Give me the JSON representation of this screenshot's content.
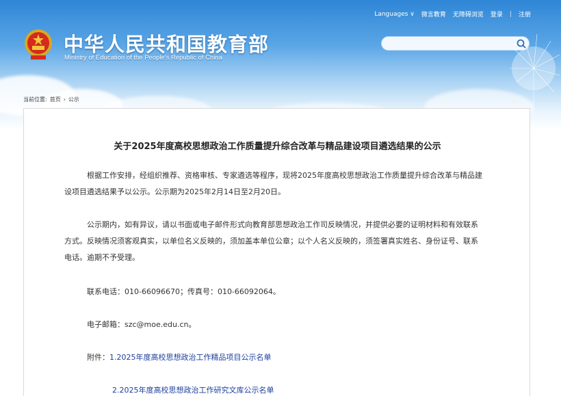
{
  "topnav": {
    "languages": "Languages",
    "weibo": "微言教育",
    "accessible": "无障碍浏览",
    "login": "登录",
    "separator": "|",
    "register": "注册"
  },
  "header": {
    "title_cn": "中华人民共和国教育部",
    "title_en": "Ministry of Education of the People's Republic of China"
  },
  "search": {
    "placeholder": "",
    "value": ""
  },
  "breadcrumb": {
    "prefix": "当前位置:",
    "home": "首页",
    "arrow": "›",
    "current": "公示"
  },
  "article": {
    "title": "关于2025年度高校思想政治工作质量提升综合改革与精品建设项目遴选结果的公示",
    "para1": "根据工作安排，经组织推荐、资格审核、专家遴选等程序，现将2025年度高校思想政治工作质量提升综合改革与精品建设项目遴选结果予以公示。公示期为2025年2月14日至2月20日。",
    "para2": "公示期内，如有异议，请以书面或电子邮件形式向教育部思想政治工作司反映情况，并提供必要的证明材料和有效联系方式。反映情况须客观真实，以单位名义反映的，须加盖本单位公章；以个人名义反映的，须签署真实姓名、身份证号、联系电话。逾期不予受理。",
    "contact": "联系电话：010-66096670；传真号：010-66092064。",
    "email": "电子邮箱：szc@moe.edu.cn。",
    "attachment_label": "附件：",
    "attachment1": "1.2025年度高校思想政治工作精品项目公示名单",
    "attachment2": "2.2025年度高校思想政治工作研究文库公示名单"
  },
  "colors": {
    "header_top": "#2f86d6",
    "link": "#1d3f9e",
    "text": "#333333"
  },
  "icons": {
    "emblem": "national-emblem",
    "search": "search-icon",
    "dropdown": "chevron-down-icon"
  }
}
